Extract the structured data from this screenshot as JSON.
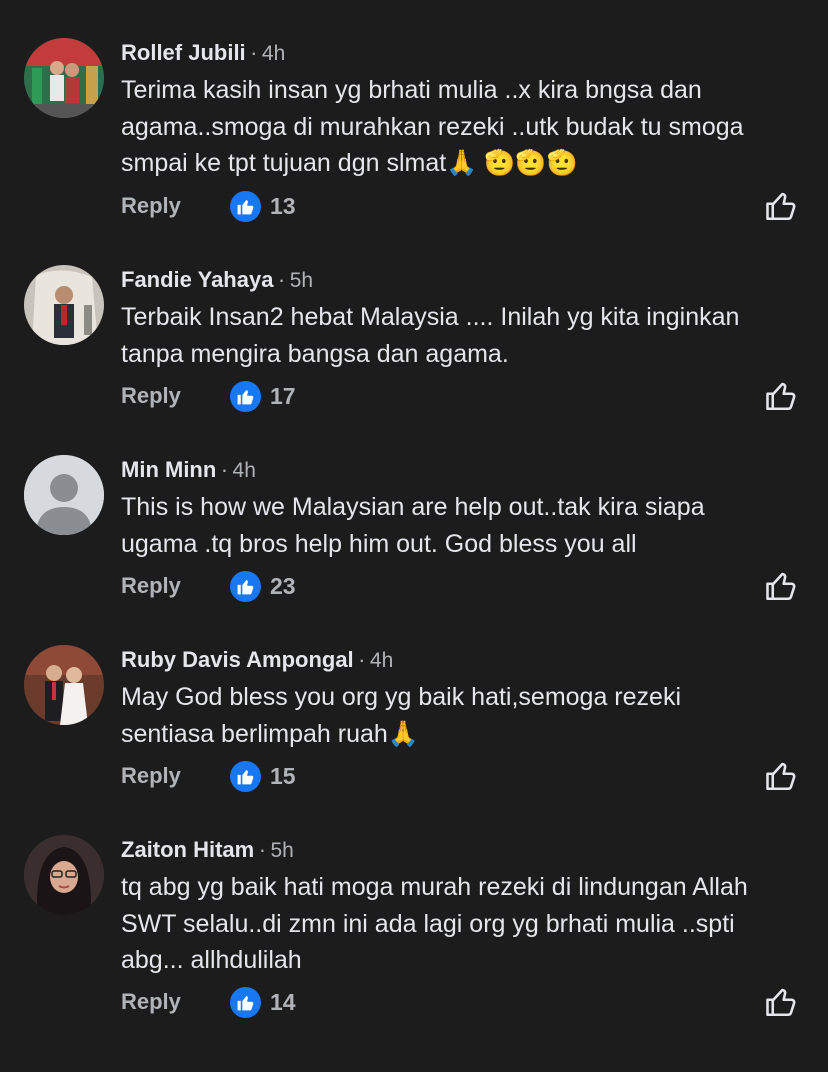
{
  "comments": [
    {
      "author": "Rollef Jubili",
      "separator": "·",
      "time": "4h",
      "text": "Terima kasih insan yg brhati mulia ..x kira bngsa dan\nagama..smoga di murahkan rezeki ..utk budak tu smoga\nsmpai ke tpt tujuan dgn slmat🙏 🫡🫡🫡",
      "reply_label": "Reply",
      "likes": "13"
    },
    {
      "author": "Fandie Yahaya",
      "separator": "·",
      "time": "5h",
      "text": "Terbaik Insan2 hebat Malaysia .... Inilah yg kita inginkan\ntanpa mengira bangsa dan agama.",
      "reply_label": "Reply",
      "likes": "17"
    },
    {
      "author": "Min Minn",
      "separator": "·",
      "time": "4h",
      "text": "This is how we Malaysian are help out..tak kira siapa\nugama .tq bros help him out. God bless you all",
      "reply_label": "Reply",
      "likes": "23"
    },
    {
      "author": "Ruby Davis Ampongal",
      "separator": "·",
      "time": "4h",
      "text": "May God bless you org yg baik hati,semoga rezeki\nsentiasa berlimpah ruah🙏",
      "reply_label": "Reply",
      "likes": "15"
    },
    {
      "author": "Zaiton Hitam",
      "separator": "·",
      "time": "5h",
      "text": "tq abg yg baik hati moga murah rezeki di lindungan Allah\nSWT selalu..di zmn ini ada lagi org yg brhati mulia ..spti\nabg... allhdulilah",
      "reply_label": "Reply",
      "likes": "14"
    }
  ],
  "colors": {
    "background": "#1c1c1d",
    "primary_text": "#e4e6eb",
    "secondary_text": "#b0b3b8",
    "like_badge": "#1877f2"
  },
  "icons": {
    "like_badge": "thumbs-up-icon",
    "like_action": "thumbs-up-outline-icon",
    "default_avatar": "person-silhouette-icon"
  }
}
